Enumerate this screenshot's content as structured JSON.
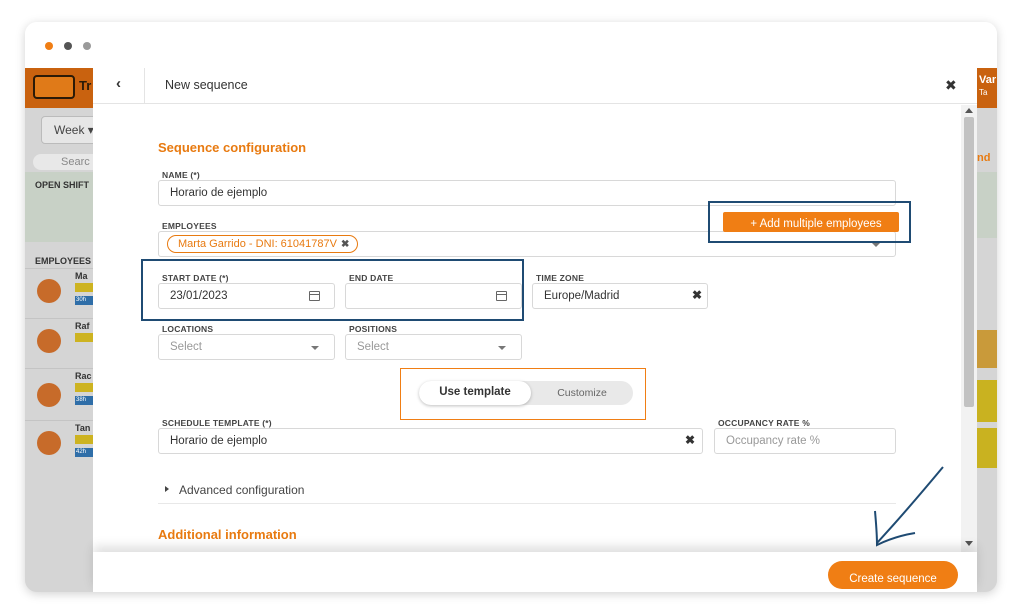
{
  "window": {
    "dots": [
      "#f07e14",
      "#555555",
      "#9a9a9a"
    ]
  },
  "background_app": {
    "brand": "Tr",
    "week_label": "Week ▾",
    "search_placeholder": "Searc",
    "open_shifts": "OPEN SHIFT",
    "employees_heading": "EMPLOYEES",
    "rows": [
      {
        "name": "Ma",
        "hours": "30h"
      },
      {
        "name": "Raf",
        "hours": ""
      },
      {
        "name": "Rac",
        "hours": "38h"
      },
      {
        "name": "Tan",
        "hours": "42h"
      }
    ],
    "right_header": "Var",
    "right_sub": "Ta",
    "right_label": "nd"
  },
  "modal": {
    "title": "New sequence",
    "back_icon": "chevron-left-icon",
    "close_icon": "close-icon",
    "section_config": "Sequence configuration",
    "name_label": "NAME (*)",
    "name_value": "Horario de ejemplo",
    "employees_label": "EMPLOYEES",
    "employee_chip": "Marta Garrido - DNI: 61041787V",
    "add_multiple_label": "+ Add multiple employees",
    "start_date_label": "START DATE (*)",
    "start_date_value": "23/01/2023",
    "end_date_label": "END DATE",
    "end_date_value": "",
    "timezone_label": "TIME ZONE",
    "timezone_value": "Europe/Madrid",
    "locations_label": "LOCATIONS",
    "locations_placeholder": "Select",
    "positions_label": "POSITIONS",
    "positions_placeholder": "Select",
    "toggle_use_template": "Use template",
    "toggle_customize": "Customize",
    "schedule_template_label": "SCHEDULE TEMPLATE (*)",
    "schedule_template_value": "Horario de ejemplo",
    "occupancy_label": "OCCUPANCY RATE %",
    "occupancy_placeholder": "Occupancy rate %",
    "advanced_label": "Advanced configuration",
    "section_additional": "Additional information",
    "create_button": "Create sequence"
  },
  "colors": {
    "accent": "#f07e14",
    "highlight_blue": "#1f4b73",
    "highlight_orange": "#f07e14"
  }
}
